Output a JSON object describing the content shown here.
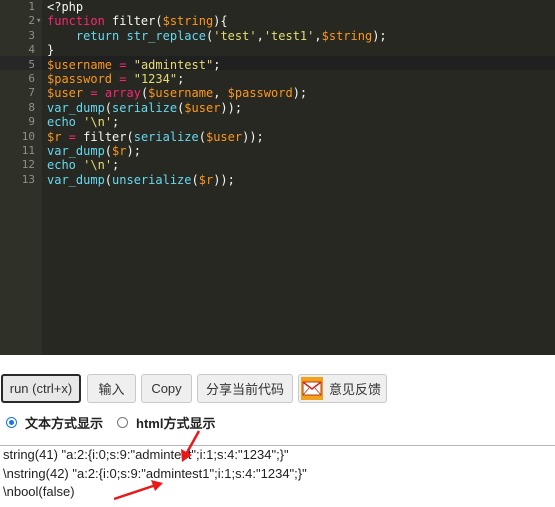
{
  "editor": {
    "lines": [
      {
        "n": "1",
        "fold": "",
        "tokens": [
          {
            "t": "<?php",
            "c": "pl"
          }
        ]
      },
      {
        "n": "2",
        "fold": "▾",
        "tokens": [
          {
            "t": "function",
            "c": "kw"
          },
          {
            "t": " filter(",
            "c": "pl"
          },
          {
            "t": "$string",
            "c": "var"
          },
          {
            "t": "){",
            "c": "pl"
          }
        ]
      },
      {
        "n": "3",
        "fold": "",
        "tokens": [
          {
            "t": "    ",
            "c": "pl"
          },
          {
            "t": "return",
            "c": "fn"
          },
          {
            "t": " ",
            "c": "pl"
          },
          {
            "t": "str_replace",
            "c": "fn"
          },
          {
            "t": "(",
            "c": "pl"
          },
          {
            "t": "'test'",
            "c": "str"
          },
          {
            "t": ",",
            "c": "pl"
          },
          {
            "t": "'test1'",
            "c": "str"
          },
          {
            "t": ",",
            "c": "pl"
          },
          {
            "t": "$string",
            "c": "var"
          },
          {
            "t": ");",
            "c": "pl"
          }
        ]
      },
      {
        "n": "4",
        "fold": "",
        "tokens": [
          {
            "t": "}",
            "c": "pl"
          }
        ]
      },
      {
        "n": "5",
        "fold": "",
        "tokens": [
          {
            "t": "$username",
            "c": "var"
          },
          {
            "t": " = ",
            "c": "op"
          },
          {
            "t": "\"admintest\"",
            "c": "str"
          },
          {
            "t": ";",
            "c": "pl"
          }
        ]
      },
      {
        "n": "6",
        "fold": "",
        "tokens": [
          {
            "t": "$password",
            "c": "var"
          },
          {
            "t": " = ",
            "c": "op"
          },
          {
            "t": "\"1234\"",
            "c": "str"
          },
          {
            "t": ";",
            "c": "pl"
          }
        ]
      },
      {
        "n": "7",
        "fold": "",
        "tokens": [
          {
            "t": "$user",
            "c": "var"
          },
          {
            "t": " = ",
            "c": "op"
          },
          {
            "t": "array",
            "c": "kw"
          },
          {
            "t": "(",
            "c": "pl"
          },
          {
            "t": "$username",
            "c": "var"
          },
          {
            "t": ", ",
            "c": "pl"
          },
          {
            "t": "$password",
            "c": "var"
          },
          {
            "t": ");",
            "c": "pl"
          }
        ]
      },
      {
        "n": "8",
        "fold": "",
        "tokens": [
          {
            "t": "var_dump",
            "c": "fn"
          },
          {
            "t": "(",
            "c": "pl"
          },
          {
            "t": "serialize",
            "c": "fn"
          },
          {
            "t": "(",
            "c": "pl"
          },
          {
            "t": "$user",
            "c": "var"
          },
          {
            "t": "));",
            "c": "pl"
          }
        ]
      },
      {
        "n": "9",
        "fold": "",
        "tokens": [
          {
            "t": "echo",
            "c": "fn"
          },
          {
            "t": " ",
            "c": "pl"
          },
          {
            "t": "'\\n'",
            "c": "str"
          },
          {
            "t": ";",
            "c": "pl"
          }
        ]
      },
      {
        "n": "10",
        "fold": "",
        "tokens": [
          {
            "t": "$r",
            "c": "var"
          },
          {
            "t": " = ",
            "c": "op"
          },
          {
            "t": "filter(",
            "c": "pl"
          },
          {
            "t": "serialize",
            "c": "fn"
          },
          {
            "t": "(",
            "c": "pl"
          },
          {
            "t": "$user",
            "c": "var"
          },
          {
            "t": "));",
            "c": "pl"
          }
        ]
      },
      {
        "n": "11",
        "fold": "",
        "tokens": [
          {
            "t": "var_dump",
            "c": "fn"
          },
          {
            "t": "(",
            "c": "pl"
          },
          {
            "t": "$r",
            "c": "var"
          },
          {
            "t": ");",
            "c": "pl"
          }
        ]
      },
      {
        "n": "12",
        "fold": "",
        "tokens": [
          {
            "t": "echo",
            "c": "fn"
          },
          {
            "t": " ",
            "c": "pl"
          },
          {
            "t": "'\\n'",
            "c": "str"
          },
          {
            "t": ";",
            "c": "pl"
          }
        ]
      },
      {
        "n": "13",
        "fold": "",
        "tokens": [
          {
            "t": "var_dump",
            "c": "fn"
          },
          {
            "t": "(",
            "c": "pl"
          },
          {
            "t": "unserialize",
            "c": "fn"
          },
          {
            "t": "(",
            "c": "pl"
          },
          {
            "t": "$r",
            "c": "var"
          },
          {
            "t": "));",
            "c": "pl"
          }
        ]
      }
    ]
  },
  "toolbar": {
    "run_label": "run (ctrl+x)",
    "input_label": "输入",
    "copy_label": "Copy",
    "share_label": "分享当前代码",
    "feedback_label": "意见反馈",
    "feedback_icon": "mail-icon"
  },
  "display_mode": {
    "text_label": "文本方式显示",
    "html_label": "html方式显示",
    "selected": "text"
  },
  "output": {
    "lines": [
      "string(41) \"a:2:{i:0;s:9:\"admintest\";i:1;s:4:\"1234\";}\"",
      "\\nstring(42) \"a:2:{i:0;s:9:\"admintest1\";i:1;s:4:\"1234\";}\"",
      "\\nbool(false)"
    ]
  },
  "colors": {
    "editor_bg": "#272822",
    "keyword": "#f92672",
    "variable": "#fd971f",
    "string": "#e6db74",
    "function": "#66d9ef",
    "annotation_arrow": "#e8191b",
    "radio_accent": "#1a73e8"
  }
}
